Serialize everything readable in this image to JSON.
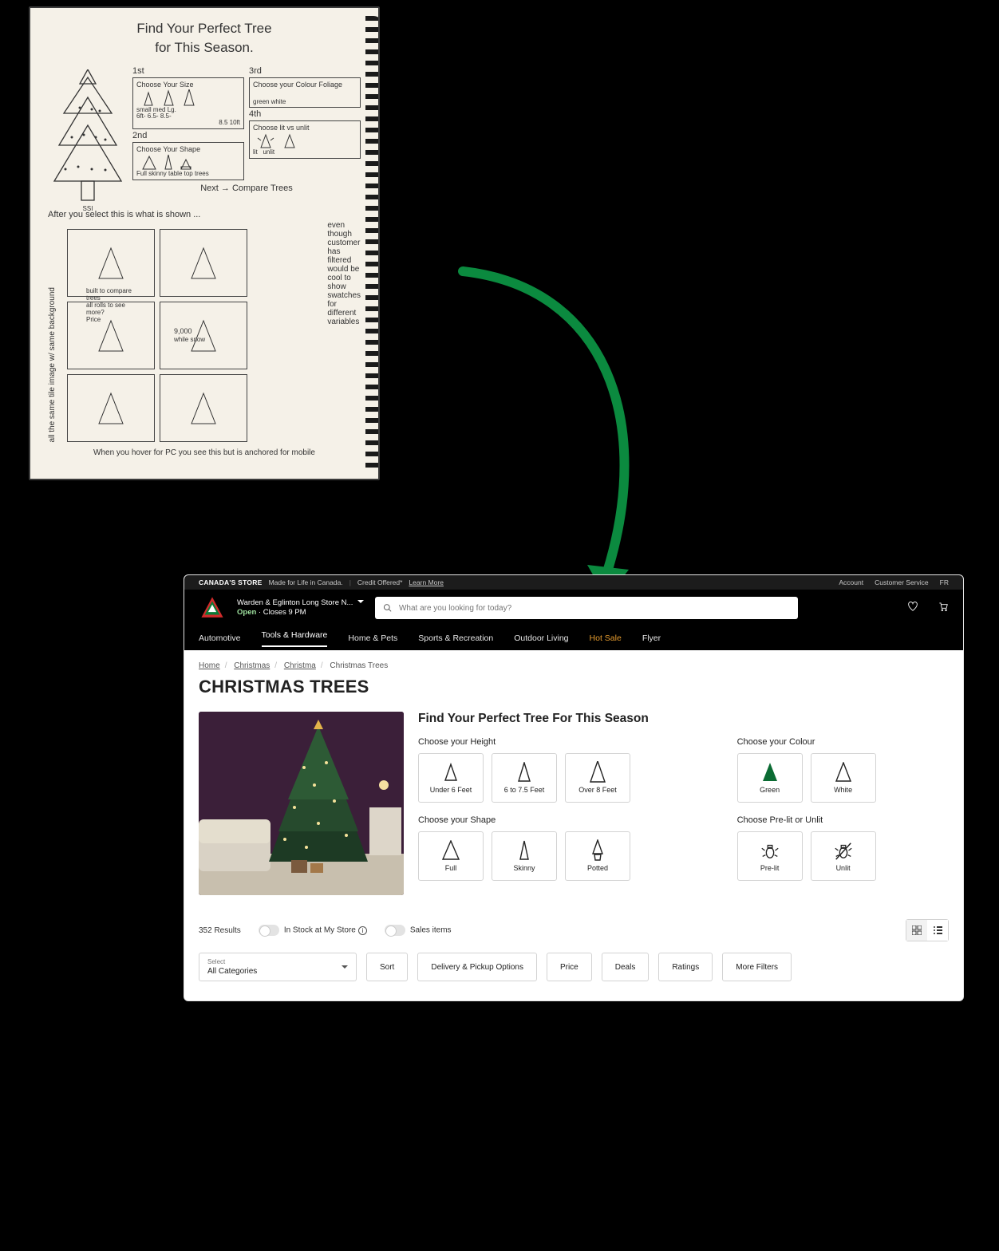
{
  "sketch": {
    "title_line1": "Find Your Perfect Tree",
    "title_line2": "for This Season.",
    "box1_title": "Choose Your Size",
    "box1_items": [
      "small",
      "med",
      "Lg.",
      "6ft-",
      "6.5-",
      "8.5-",
      "8.5",
      "10ft"
    ],
    "box2_title": "Choose Your Shape",
    "box2_items": [
      "Full",
      "skinny",
      "table top trees"
    ],
    "box3_title": "Choose your Colour Foliage",
    "box3_items": [
      "green",
      "white"
    ],
    "box4_title": "Choose lit vs unlit",
    "box4_items": [
      "lit",
      "unlit"
    ],
    "labels": {
      "first": "1st",
      "second": "2nd",
      "third": "3rd",
      "fourth": "4th"
    },
    "next_line": "Next → Compare Trees",
    "after_line": "After you select this is what is shown ...",
    "side_note_right": "even though customer has filtered would be cool to show swatches for different variables",
    "side_note_left": "all the same tile image w/ same background",
    "grid_notes": [
      "built to compare trees",
      "all rolls to see more?",
      "Price",
      "9,000",
      "while snow"
    ],
    "bottom_note": "When you hover for PC you see this but is anchored for mobile",
    "ss_label": "SSI"
  },
  "util": {
    "brand": "CANADA'S STORE",
    "tag": "Made for Life in Canada.",
    "credit_pre": "Credit Offered*",
    "credit_link": "Learn More",
    "links": [
      "Account",
      "Customer Service",
      "FR"
    ]
  },
  "store": {
    "name": "Warden & Eglinton Long Store N...",
    "status": "Open",
    "hours": "Closes 9 PM"
  },
  "search": {
    "placeholder": "What are you looking for today?"
  },
  "nav": [
    "Automotive",
    "Tools & Hardware",
    "Home & Pets",
    "Sports & Recreation",
    "Outdoor Living",
    "Hot Sale",
    "Flyer"
  ],
  "active_nav": "Tools & Hardware",
  "hot_nav": "Hot Sale",
  "breadcrumbs": [
    "Home",
    "Christmas",
    "Christma",
    "Christmas Trees"
  ],
  "h1": "CHRISTMAS TREES",
  "finder": {
    "title": "Find Your Perfect Tree For This Season",
    "height": {
      "label": "Choose your Height",
      "options": [
        "Under 6 Feet",
        "6 to 7.5 Feet",
        "Over 8 Feet"
      ]
    },
    "colour": {
      "label": "Choose your Colour",
      "options": [
        "Green",
        "White"
      ]
    },
    "shape": {
      "label": "Choose your Shape",
      "options": [
        "Full",
        "Skinny",
        "Potted"
      ]
    },
    "lit": {
      "label": "Choose Pre-lit or Unlit",
      "options": [
        "Pre-lit",
        "Unlit"
      ]
    }
  },
  "results": {
    "count": "352 Results",
    "toggle1": "In Stock at My Store",
    "toggle2": "Sales items"
  },
  "filters": {
    "select_label": "Select",
    "select_value": "All Categories",
    "buttons": [
      "Sort",
      "Delivery & Pickup Options",
      "Price",
      "Deals",
      "Ratings",
      "More Filters"
    ]
  },
  "colors": {
    "accent_green": "#0b8a3f",
    "hot": "#e39a2e"
  }
}
